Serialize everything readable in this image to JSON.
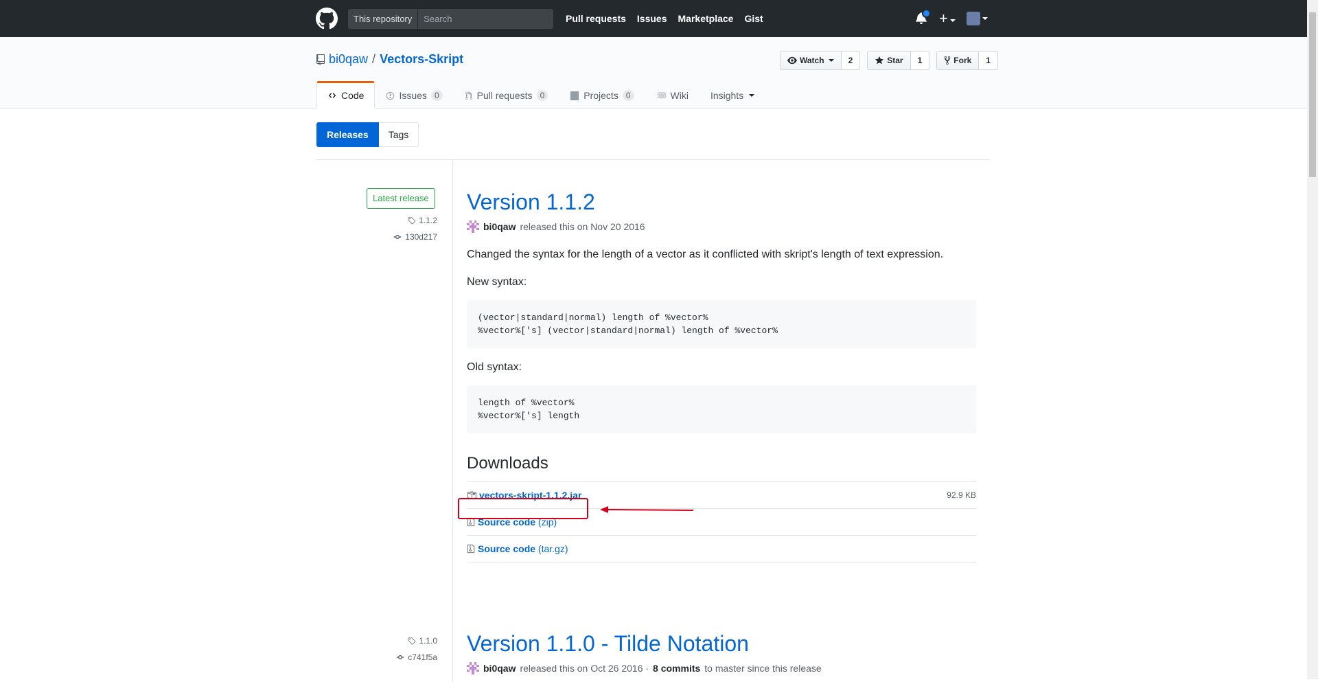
{
  "header": {
    "scope_label": "This repository",
    "search_placeholder": "Search",
    "nav": [
      "Pull requests",
      "Issues",
      "Marketplace",
      "Gist"
    ]
  },
  "repo": {
    "owner": "bi0qaw",
    "separator": "/",
    "name": "Vectors-Skript",
    "watch_label": "Watch",
    "watch_count": "2",
    "star_label": "Star",
    "star_count": "1",
    "fork_label": "Fork",
    "fork_count": "1"
  },
  "tabs": [
    {
      "label": "Code"
    },
    {
      "label": "Issues",
      "count": "0"
    },
    {
      "label": "Pull requests",
      "count": "0"
    },
    {
      "label": "Projects",
      "count": "0"
    },
    {
      "label": "Wiki"
    },
    {
      "label": "Insights"
    }
  ],
  "subnav": {
    "releases": "Releases",
    "tags": "Tags"
  },
  "release1": {
    "badge": "Latest release",
    "tag": "1.1.2",
    "commit": "130d217",
    "title": "Version 1.1.2",
    "author": "bi0qaw",
    "released_text": "released this on Nov 20 2016",
    "description": "Changed the syntax for the length of a vector as it conflicted with skript's length of text expression.",
    "new_syntax_label": "New syntax:",
    "new_syntax_code": "(vector|standard|normal) length of %vector%\n%vector%['s] (vector|standard|normal) length of %vector%",
    "old_syntax_label": "Old syntax:",
    "old_syntax_code": "length of %vector%\n%vector%['s] length",
    "downloads_heading": "Downloads",
    "downloads": [
      {
        "name": "vectors-skript-1.1.2.jar",
        "ext": "",
        "size": "92.9 KB"
      },
      {
        "name": "Source code",
        "ext": "(zip)",
        "size": ""
      },
      {
        "name": "Source code",
        "ext": "(tar.gz)",
        "size": ""
      }
    ]
  },
  "release2": {
    "tag": "1.1.0",
    "commit": "c741f5a",
    "title": "Version 1.1.0 - Tilde Notation",
    "author": "bi0qaw",
    "released_text": "released this on Oct 26 2016 ·",
    "commits": "8 commits",
    "commits_suffix": "to master since this release"
  },
  "colors": {
    "header_bg": "#24292e",
    "link": "#0366d6",
    "accent_tab": "#e36209",
    "latest_green": "#28a745",
    "annotation_red": "#d0021b"
  }
}
